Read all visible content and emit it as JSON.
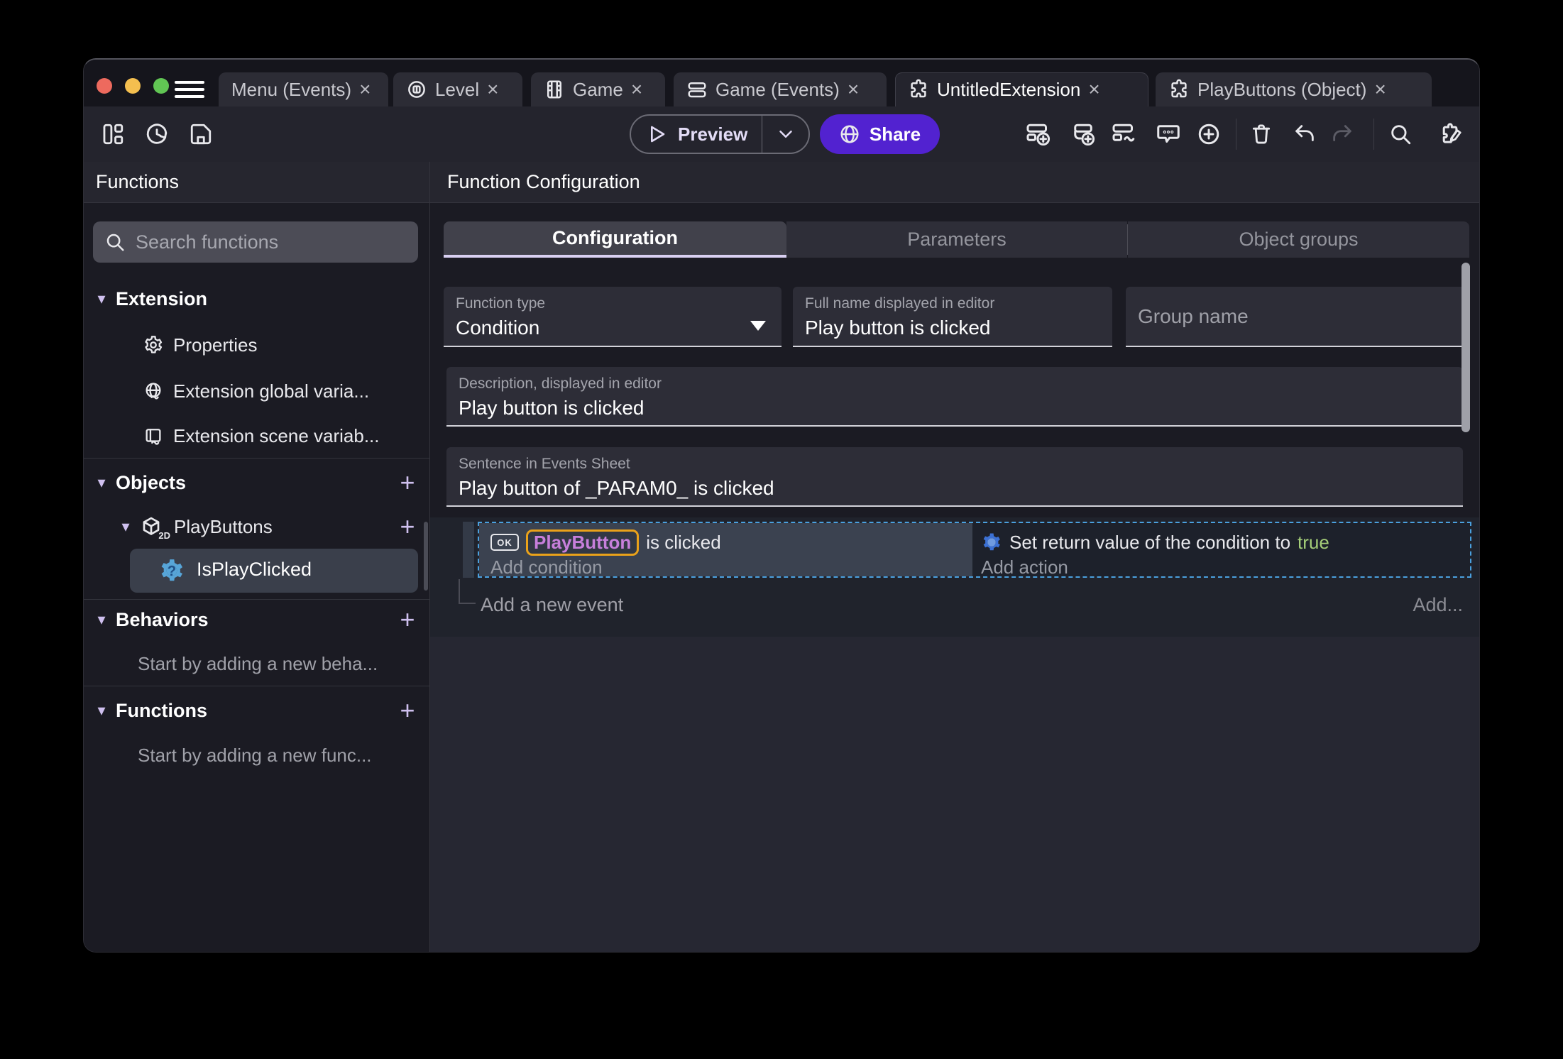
{
  "colors": {
    "accent_lavender": "#cfc0ef",
    "share_purple": "#5222d0",
    "selection_blue": "#4aa0de",
    "object_chip_orange": "#eaa21a",
    "object_name_purple": "#c77fdb",
    "boolean_true_green": "#a5ce79",
    "function_gear_blue": "#3c71d4",
    "traffic_red": "#ed6a5e",
    "traffic_yellow": "#f4bf4f",
    "traffic_green": "#61c554"
  },
  "icons": {
    "close_glyph": "×",
    "plus_glyph": "+",
    "caret_glyph": "▾",
    "cube_badge": "2D",
    "ok_button_label": "OK"
  },
  "tabs": [
    {
      "label": "Menu (Events)"
    },
    {
      "label": "Level"
    },
    {
      "label": "Game"
    },
    {
      "label": "Game (Events)"
    },
    {
      "label": "UntitledExtension"
    },
    {
      "label": "PlayButtons (Object)"
    }
  ],
  "toolbar": {
    "preview_label": "Preview",
    "share_label": "Share"
  },
  "sidebar": {
    "title": "Functions",
    "search_placeholder": "Search functions",
    "items": [
      {
        "label": "Extension"
      },
      {
        "label": "Properties"
      },
      {
        "label": "Extension global varia..."
      },
      {
        "label": "Extension scene variab..."
      },
      {
        "label": "Objects"
      },
      {
        "label": "PlayButtons"
      },
      {
        "label": "IsPlayClicked"
      },
      {
        "label": "Behaviors"
      },
      {
        "label": "Start by adding a new beha..."
      },
      {
        "label": "Functions"
      },
      {
        "label": "Start by adding a new func..."
      }
    ]
  },
  "main": {
    "title": "Function Configuration",
    "tabs": [
      {
        "label": "Configuration"
      },
      {
        "label": "Parameters"
      },
      {
        "label": "Object groups"
      }
    ],
    "form": {
      "function_type": {
        "label": "Function type",
        "value": "Condition"
      },
      "full_name": {
        "label": "Full name displayed in editor",
        "value": "Play button is clicked"
      },
      "group_name": {
        "placeholder": "Group name"
      },
      "description": {
        "label": "Description, displayed in editor",
        "value": "Play button is clicked"
      },
      "sentence": {
        "label": "Sentence in Events Sheet",
        "value": "Play button of _PARAM0_ is clicked"
      }
    },
    "events": {
      "condition": {
        "object_name": "PlayButton",
        "text": "is clicked",
        "add_label": "Add condition"
      },
      "action": {
        "text": "Set return value of the condition to",
        "value": "true",
        "add_label": "Add action"
      },
      "add_event_label": "Add a new event",
      "add_button_label": "Add..."
    }
  }
}
